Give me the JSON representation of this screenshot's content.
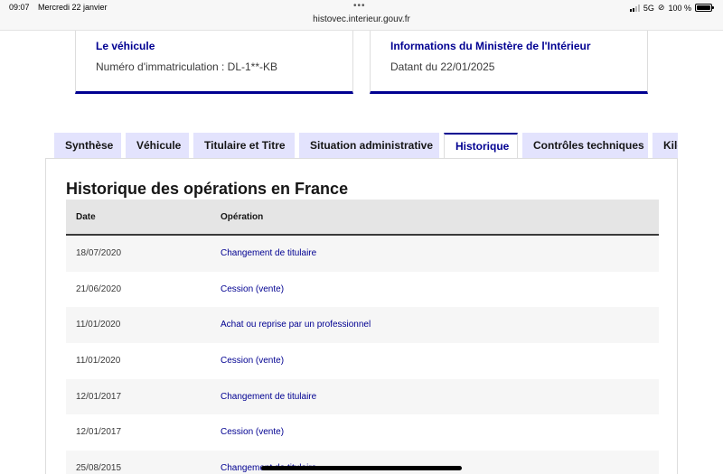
{
  "status_bar": {
    "time": "09:07",
    "date": "Mercredi 22 janvier",
    "dots": "•••",
    "url": "histovec.interieur.gouv.fr",
    "network": "5G",
    "battery": "100 %",
    "battery_level": 1.0
  },
  "cards": [
    {
      "title": "Le véhicule",
      "text": "Numéro d'immatriculation : DL-1**-KB"
    },
    {
      "title": "Informations du Ministère de l'Intérieur",
      "text": "Datant du 22/01/2025"
    }
  ],
  "tabs": [
    {
      "label": "Synthèse",
      "active": false
    },
    {
      "label": "Véhicule",
      "active": false
    },
    {
      "label": "Titulaire et Titre",
      "active": false
    },
    {
      "label": "Situation administrative",
      "active": false
    },
    {
      "label": "Historique",
      "active": true
    },
    {
      "label": "Contrôles techniques",
      "active": false
    },
    {
      "label": "Kilo",
      "active": false
    }
  ],
  "history": {
    "title": "Historique des opérations en France",
    "columns": {
      "date": "Date",
      "operation": "Opération"
    },
    "rows": [
      {
        "date": "18/07/2020",
        "operation": "Changement de titulaire"
      },
      {
        "date": "21/06/2020",
        "operation": "Cession (vente)"
      },
      {
        "date": "11/01/2020",
        "operation": "Achat ou reprise par un professionnel"
      },
      {
        "date": "11/01/2020",
        "operation": "Cession (vente)"
      },
      {
        "date": "12/01/2017",
        "operation": "Changement de titulaire"
      },
      {
        "date": "12/01/2017",
        "operation": "Cession (vente)"
      },
      {
        "date": "25/08/2015",
        "operation": "Changement de titulaire"
      }
    ]
  },
  "colors": {
    "brand_blue": "#000091",
    "tab_bg": "#e3e3fd",
    "header_bg": "#e5e5e5"
  }
}
